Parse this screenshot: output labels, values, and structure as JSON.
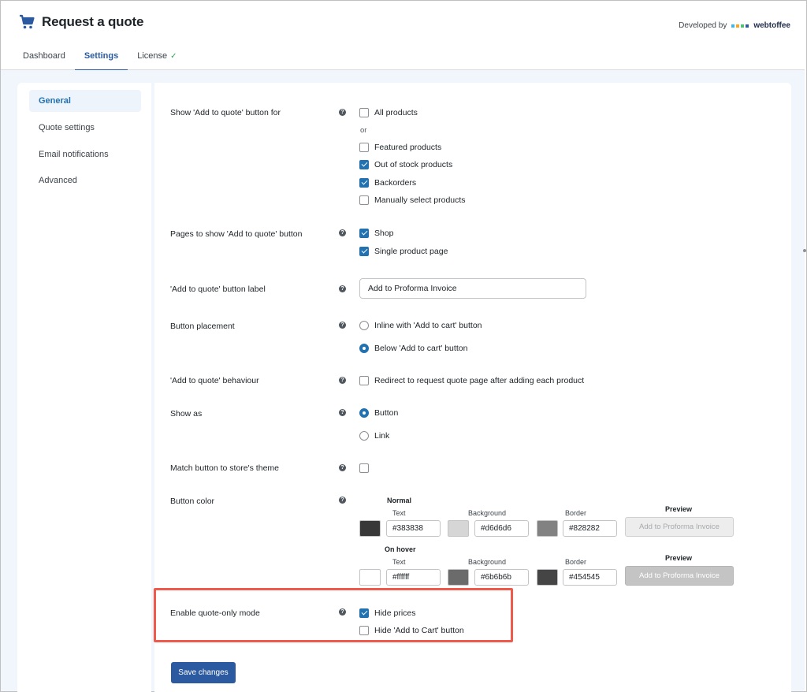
{
  "app": {
    "title": "Request a quote",
    "developed_by": "Developed by",
    "brand": "webtoffee",
    "brand_colors": [
      "#3fb6e8",
      "#f6a623",
      "#4cc36f",
      "#2c5aa0"
    ]
  },
  "tabs": [
    {
      "label": "Dashboard",
      "active": false
    },
    {
      "label": "Settings",
      "active": true
    },
    {
      "label": "License",
      "active": false,
      "check": "✓"
    }
  ],
  "sidebar": {
    "items": [
      {
        "label": "General",
        "active": true
      },
      {
        "label": "Quote settings",
        "active": false
      },
      {
        "label": "Email notifications",
        "active": false
      },
      {
        "label": "Advanced",
        "active": false
      }
    ]
  },
  "settings": {
    "show_for": {
      "label": "Show 'Add to quote' button for",
      "or_text": "or",
      "options": [
        {
          "label": "All products",
          "checked": false
        },
        {
          "label": "Featured products",
          "checked": false
        },
        {
          "label": "Out of stock products",
          "checked": true
        },
        {
          "label": "Backorders",
          "checked": true
        },
        {
          "label": "Manually select products",
          "checked": false
        }
      ]
    },
    "pages": {
      "label": "Pages to show 'Add to quote' button",
      "options": [
        {
          "label": "Shop",
          "checked": true
        },
        {
          "label": "Single product page",
          "checked": true
        }
      ]
    },
    "button_label": {
      "label": "'Add to quote' button label",
      "value": "Add to Proforma Invoice"
    },
    "placement": {
      "label": "Button placement",
      "options": [
        {
          "label": "Inline with 'Add to cart' button",
          "selected": false
        },
        {
          "label": "Below 'Add to cart' button",
          "selected": true
        }
      ]
    },
    "behaviour": {
      "label": "'Add to quote' behaviour",
      "option": {
        "label": "Redirect to request quote page after adding each product",
        "checked": false
      }
    },
    "show_as": {
      "label": "Show as",
      "options": [
        {
          "label": "Button",
          "selected": true
        },
        {
          "label": "Link",
          "selected": false
        }
      ]
    },
    "match_theme": {
      "label": "Match button to store's theme",
      "checked": false
    },
    "button_color": {
      "label": "Button color",
      "normal_title": "Normal",
      "hover_title": "On hover",
      "text_label": "Text",
      "background_label": "Background",
      "border_label": "Border",
      "preview_label": "Preview",
      "preview_button_text": "Add to Proforma Invoice",
      "normal": {
        "text": "#383838",
        "background": "#d6d6d6",
        "border": "#828282"
      },
      "hover": {
        "text": "#ffffff",
        "background": "#6b6b6b",
        "border": "#454545"
      }
    },
    "quote_only": {
      "label": "Enable quote-only mode",
      "options": [
        {
          "label": "Hide prices",
          "checked": true
        },
        {
          "label": "Hide 'Add to Cart' button",
          "checked": false
        }
      ]
    }
  },
  "save_button": "Save changes",
  "help_glyph": "?"
}
